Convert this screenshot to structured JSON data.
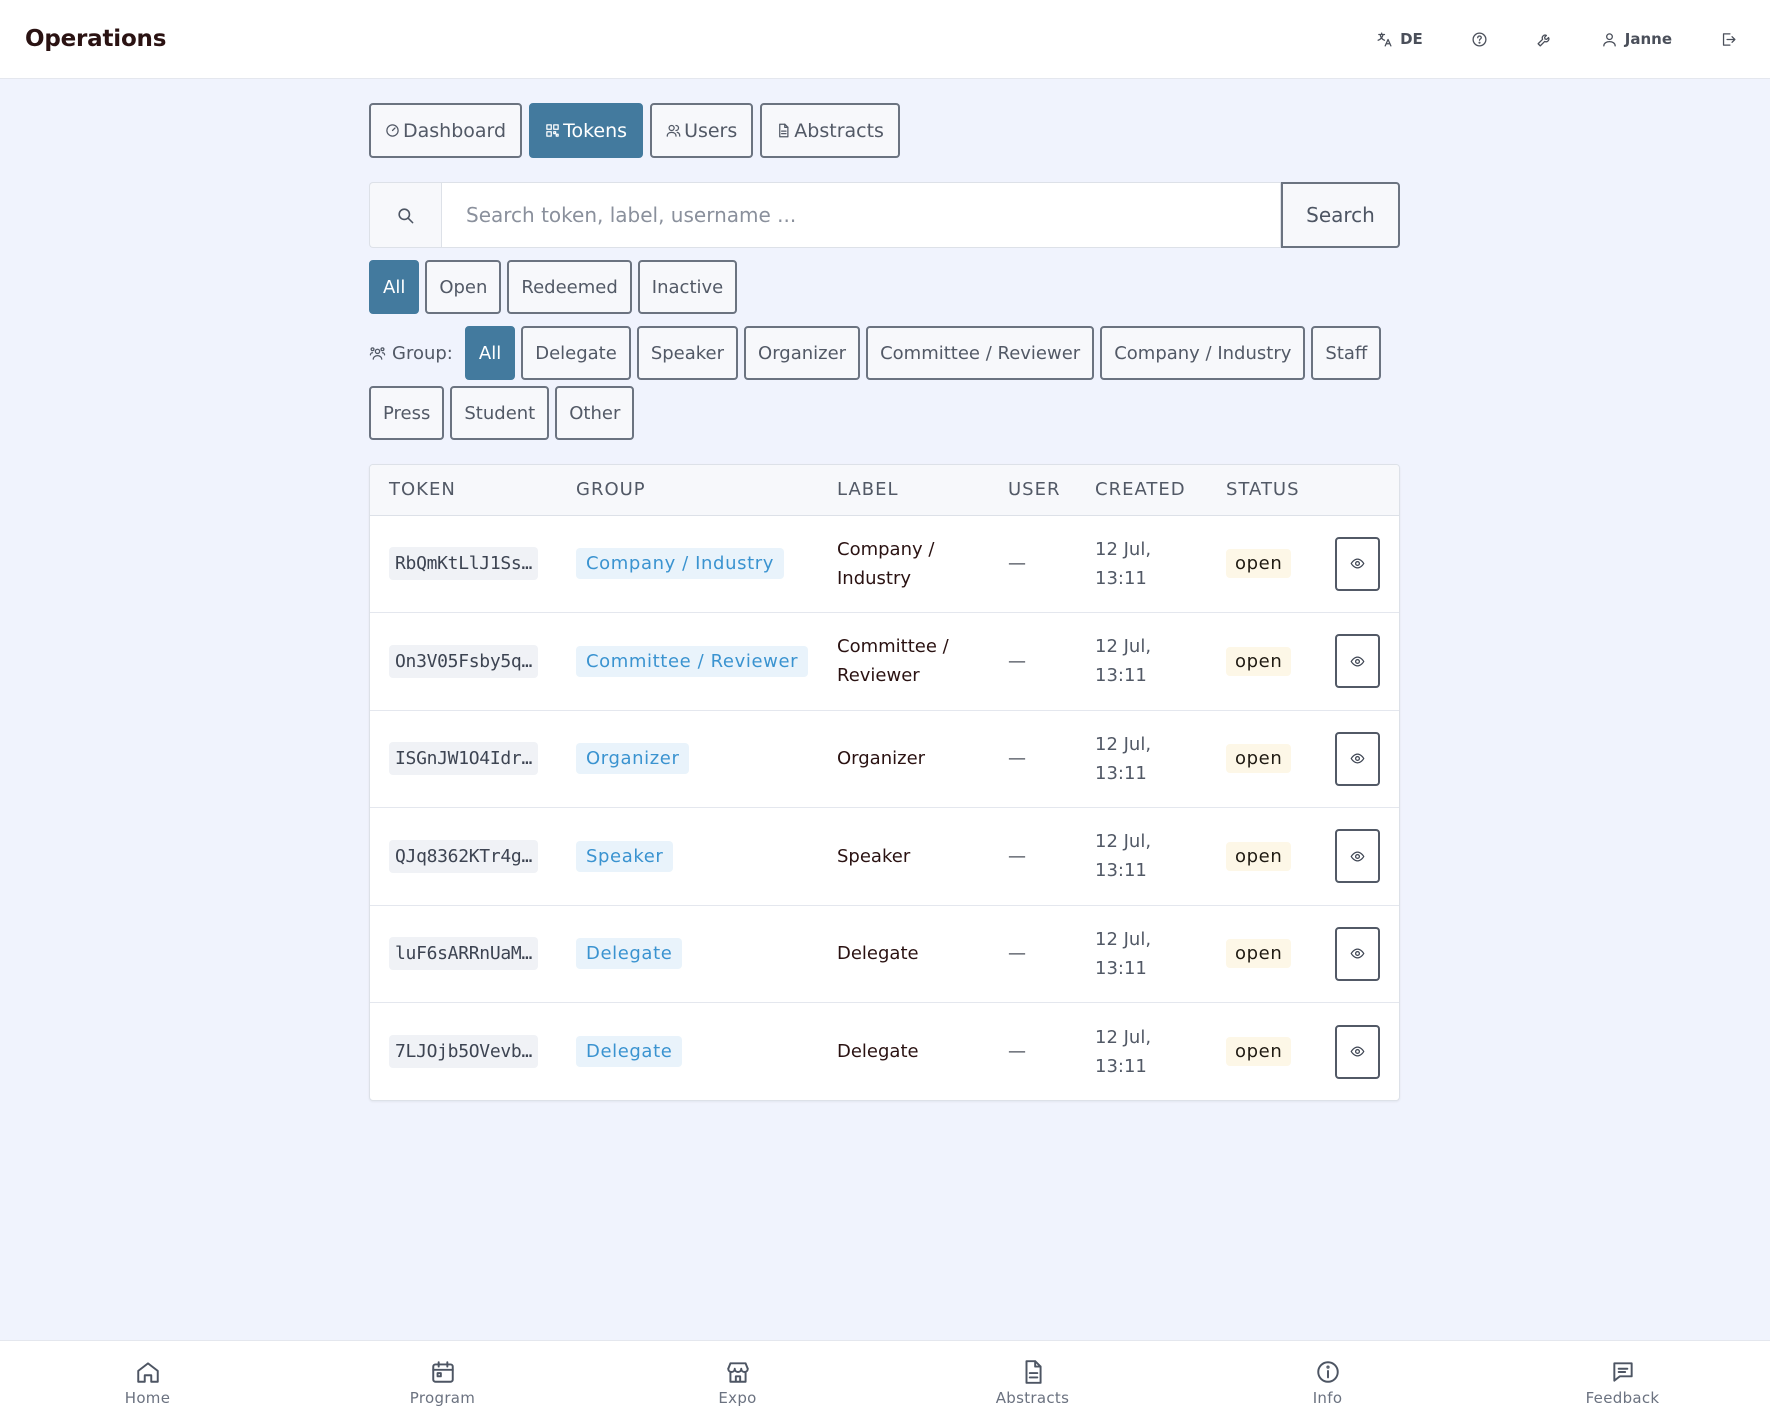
{
  "app": {
    "title": "Operations"
  },
  "topbar": {
    "language": "DE",
    "user": "Janne",
    "icons": [
      "translate-icon",
      "help-icon",
      "wrench-icon",
      "user-icon",
      "logout-icon"
    ]
  },
  "nav_tabs": [
    {
      "label": "Dashboard",
      "icon": "dashboard-icon",
      "active": false
    },
    {
      "label": "Tokens",
      "icon": "qr-icon",
      "active": true
    },
    {
      "label": "Users",
      "icon": "users-icon",
      "active": false
    },
    {
      "label": "Abstracts",
      "icon": "file-icon",
      "active": false
    }
  ],
  "search": {
    "placeholder": "Search token, label, username ...",
    "value": "",
    "button_label": "Search"
  },
  "status_filters": {
    "items": [
      "All",
      "Open",
      "Redeemed",
      "Inactive"
    ],
    "selected": "All"
  },
  "group_filters": {
    "label": "Group:",
    "items": [
      "All",
      "Delegate",
      "Speaker",
      "Organizer",
      "Committee / Reviewer",
      "Company / Industry",
      "Staff",
      "Press",
      "Student",
      "Other"
    ],
    "selected": "All"
  },
  "table": {
    "columns": [
      "TOKEN",
      "GROUP",
      "LABEL",
      "USER",
      "CREATED",
      "STATUS",
      ""
    ],
    "rows": [
      {
        "token": "RbQmKtLlJ1Ss…",
        "group": "Company / Industry",
        "label_line1": "Company /",
        "label_line2": "Industry",
        "user": "—",
        "created_line1": "12 Jul,",
        "created_line2": "13:11",
        "status": "open"
      },
      {
        "token": "On3V05Fsby5q…",
        "group": "Committee / Reviewer",
        "label_line1": "Committee /",
        "label_line2": "Reviewer",
        "user": "—",
        "created_line1": "12 Jul,",
        "created_line2": "13:11",
        "status": "open"
      },
      {
        "token": "ISGnJW1O4Idr…",
        "group": "Organizer",
        "label_line1": "Organizer",
        "label_line2": "",
        "user": "—",
        "created_line1": "12 Jul,",
        "created_line2": "13:11",
        "status": "open"
      },
      {
        "token": "QJq8362KTr4g…",
        "group": "Speaker",
        "label_line1": "Speaker",
        "label_line2": "",
        "user": "—",
        "created_line1": "12 Jul,",
        "created_line2": "13:11",
        "status": "open"
      },
      {
        "token": "luF6sARRnUaM…",
        "group": "Delegate",
        "label_line1": "Delegate",
        "label_line2": "",
        "user": "—",
        "created_line1": "12 Jul,",
        "created_line2": "13:11",
        "status": "open"
      },
      {
        "token": "7LJOjb5OVevb…",
        "group": "Delegate",
        "label_line1": "Delegate",
        "label_line2": "",
        "user": "—",
        "created_line1": "12 Jul,",
        "created_line2": "13:11",
        "status": "open"
      }
    ]
  },
  "bottom_nav": [
    {
      "label": "Home",
      "icon": "home-icon"
    },
    {
      "label": "Program",
      "icon": "calendar-icon"
    },
    {
      "label": "Expo",
      "icon": "store-icon"
    },
    {
      "label": "Abstracts",
      "icon": "document-icon"
    },
    {
      "label": "Info",
      "icon": "info-icon"
    },
    {
      "label": "Feedback",
      "icon": "message-icon"
    }
  ],
  "colors": {
    "accent": "#437a9e",
    "background": "#f0f3fd",
    "group_badge_text": "#3a93d0",
    "group_badge_bg": "#e9f3fb",
    "status_open_bg": "#fdf7e7"
  }
}
